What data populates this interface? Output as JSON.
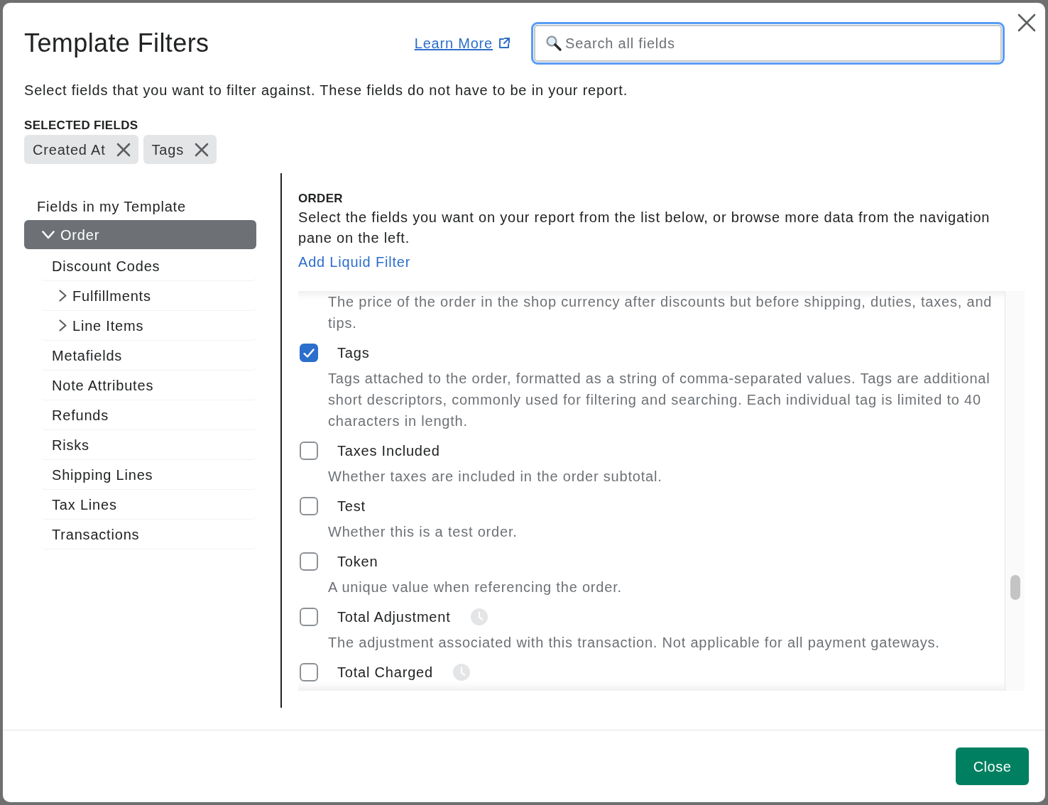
{
  "dialog": {
    "title": "Template Filters",
    "learn_more_link": "Learn More",
    "search": {
      "placeholder": "Search all fields"
    },
    "intro": "Select fields that you want to filter against. These fields do not have to be in your report."
  },
  "selected_fields": {
    "heading": "SELECTED FIELDS",
    "chips": [
      {
        "label": "Created At"
      },
      {
        "label": "Tags"
      }
    ]
  },
  "navigation": {
    "heading": "Fields in my Template",
    "items": [
      {
        "label": "Order",
        "kind": "branch",
        "expanded": true,
        "selected": true,
        "children": [
          {
            "label": "Discount Codes",
            "kind": "leaf",
            "selected": false
          },
          {
            "label": "Fulfillments",
            "kind": "branch",
            "expanded": false,
            "selected": false
          },
          {
            "label": "Line Items",
            "kind": "branch",
            "expanded": false,
            "selected": false
          },
          {
            "label": "Metafields",
            "kind": "leaf",
            "selected": false
          },
          {
            "label": "Note Attributes",
            "kind": "leaf",
            "selected": false
          },
          {
            "label": "Refunds",
            "kind": "leaf",
            "selected": false
          },
          {
            "label": "Risks",
            "kind": "leaf",
            "selected": false
          },
          {
            "label": "Shipping Lines",
            "kind": "leaf",
            "selected": false
          },
          {
            "label": "Tax Lines",
            "kind": "leaf",
            "selected": false
          },
          {
            "label": "Transactions",
            "kind": "leaf",
            "selected": false
          }
        ]
      }
    ]
  },
  "field_panel": {
    "heading": "ORDER",
    "instructions": "Select the fields you want on your report from the list below, or browse more data from the navigation pane on the left.",
    "add_liquid_filter_link": "Add Liquid Filter",
    "clipped_description": "The price of the order in the shop currency after discounts but before shipping, duties, taxes, and tips.",
    "fields": [
      {
        "name": "Tags",
        "kind": "plain",
        "checked": true,
        "description": "Tags attached to the order, formatted as a string of comma-separated values. Tags are additional short descriptors, commonly used for filtering and searching. Each individual tag is limited to 40 characters in length."
      },
      {
        "name": "Taxes Included",
        "kind": "plain",
        "checked": false,
        "description": "Whether taxes are included in the order subtotal."
      },
      {
        "name": "Test",
        "kind": "plain",
        "checked": false,
        "description": "Whether this is a test order."
      },
      {
        "name": "Token",
        "kind": "plain",
        "checked": false,
        "description": "A unique value when referencing the order."
      },
      {
        "name": "Total Adjustment",
        "kind": "clock",
        "checked": false,
        "description": "The adjustment associated with this transaction. Not applicable for all payment gateways."
      },
      {
        "name": "Total Charged",
        "kind": "clock",
        "checked": false
      }
    ]
  },
  "footer": {
    "close_button": "Close"
  }
}
